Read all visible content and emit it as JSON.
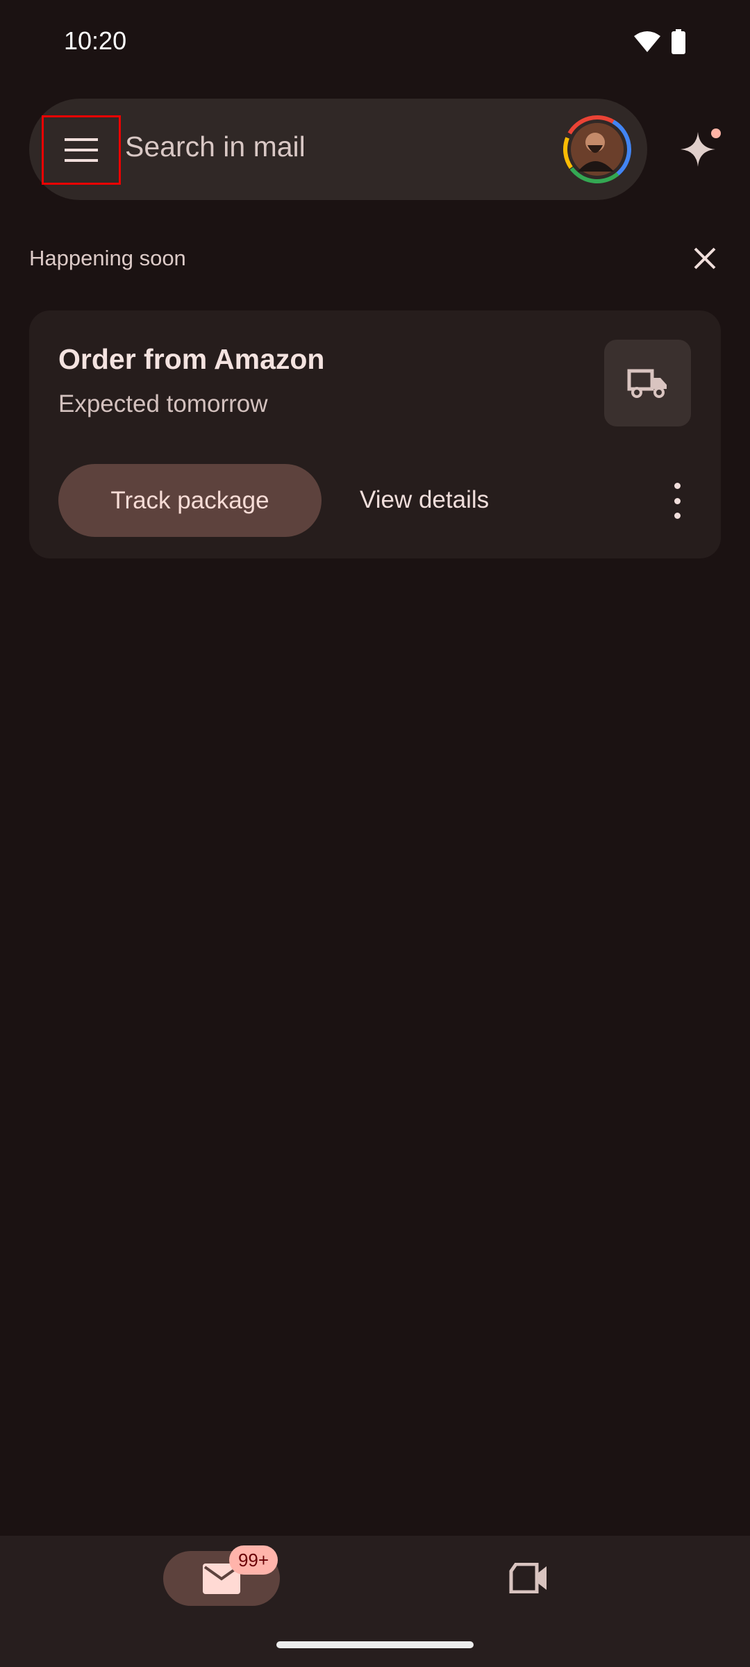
{
  "status_bar": {
    "time": "10:20",
    "icons": [
      "wifi-icon",
      "battery-icon"
    ]
  },
  "search": {
    "placeholder": "Search in mail",
    "menu_icon": "menu-icon",
    "assistant_icon": "sparkle-icon"
  },
  "section": {
    "title": "Happening soon",
    "close_icon": "close-icon"
  },
  "card": {
    "title": "Order from Amazon",
    "subtitle": "Expected tomorrow",
    "icon": "truck-icon",
    "primary_action": "Track package",
    "secondary_action": "View details"
  },
  "bottom_nav": {
    "items": [
      {
        "id": "mail",
        "icon": "mail-icon",
        "badge": "99+",
        "selected": true
      },
      {
        "id": "meet",
        "icon": "video-icon",
        "selected": false
      }
    ]
  },
  "colors": {
    "background": "#1b1212",
    "surface": "#302826",
    "card": "#261d1c",
    "accent": "#5d423d",
    "badge": "#ffb4ab"
  }
}
